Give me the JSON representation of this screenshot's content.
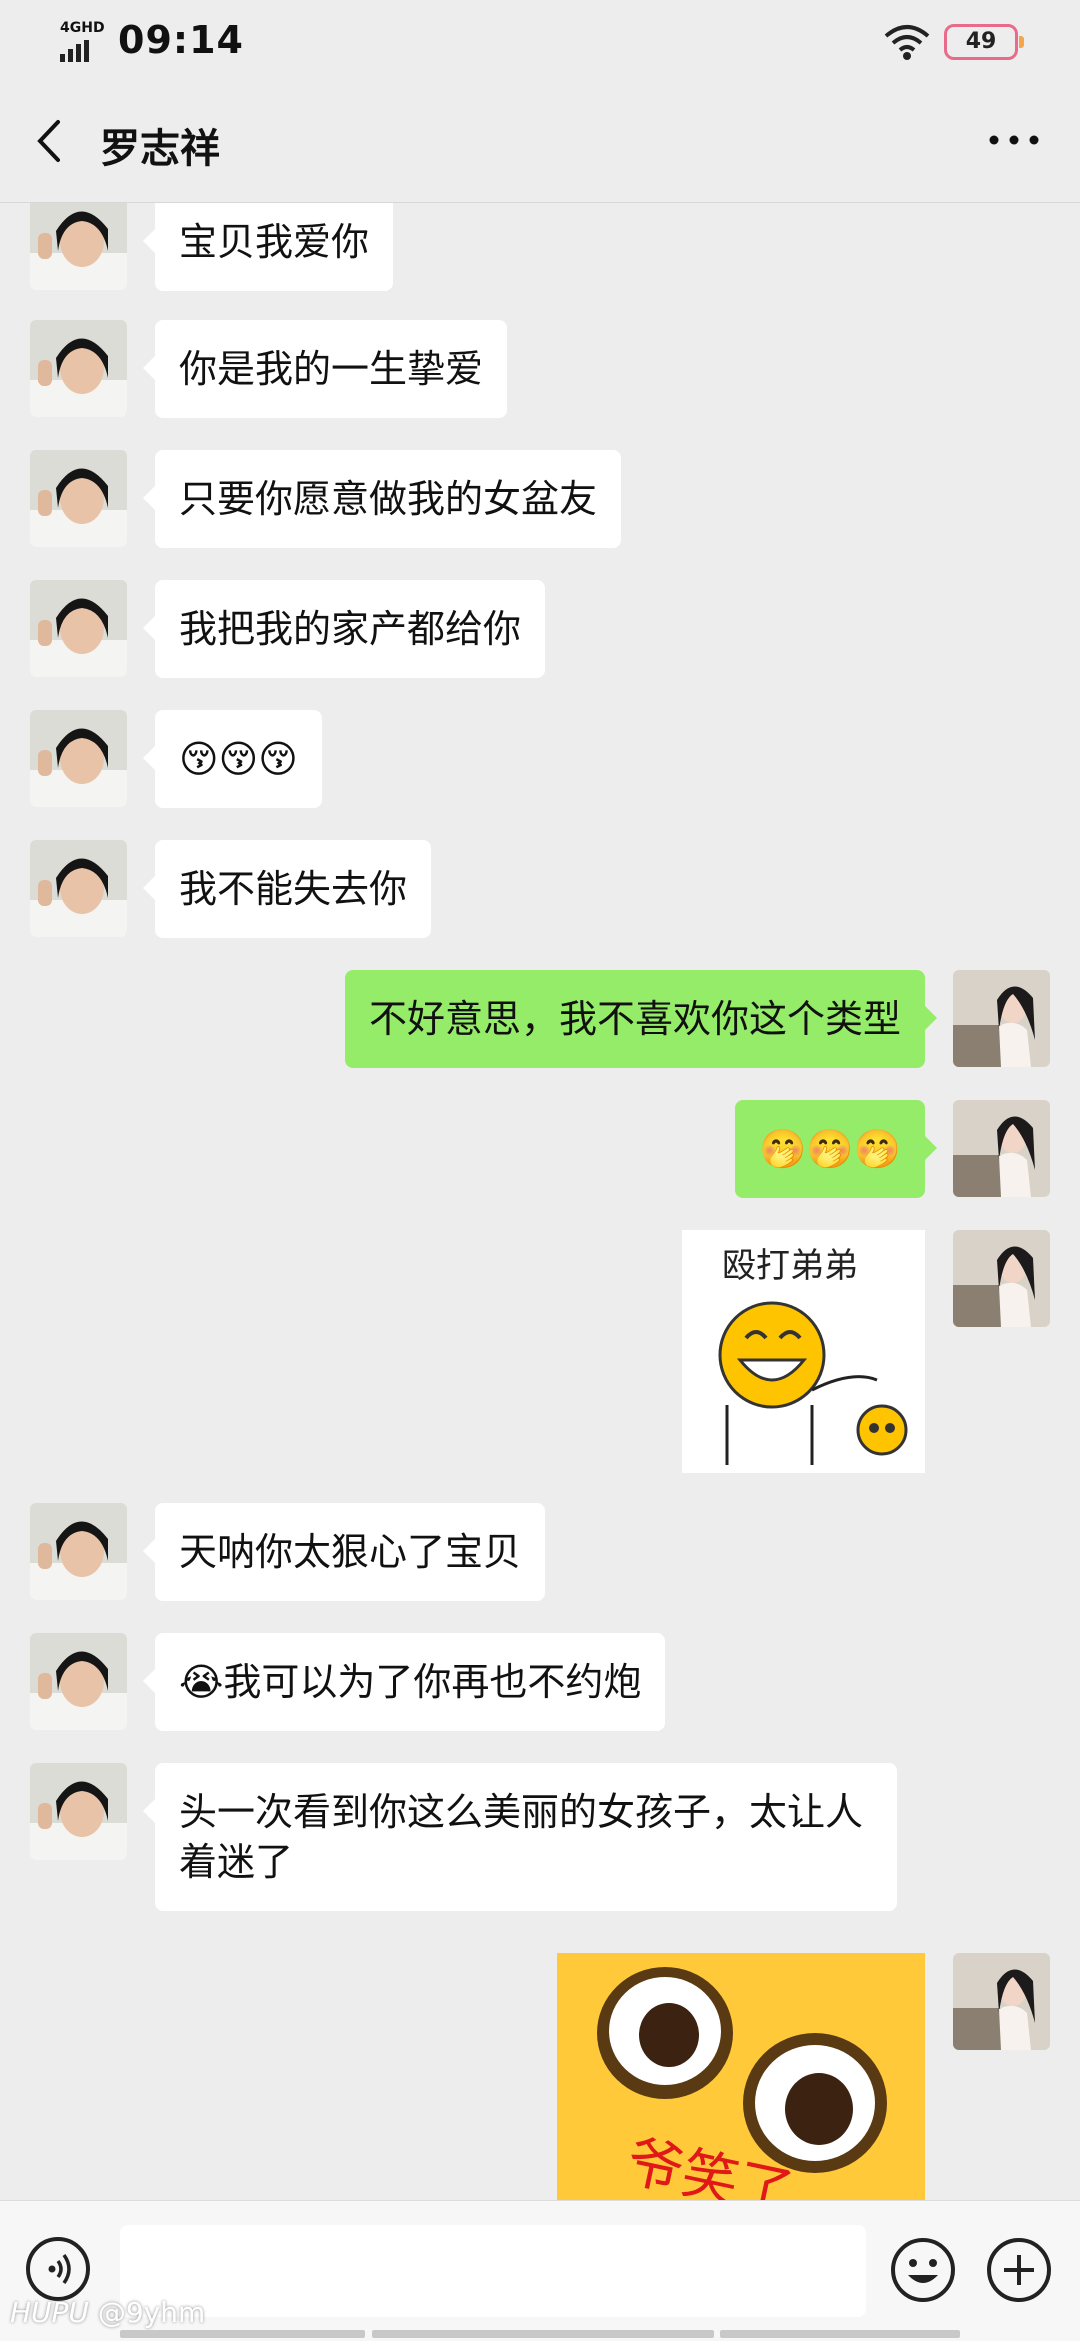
{
  "status_bar": {
    "network": "4GHD",
    "time": "09:14",
    "battery": "49"
  },
  "header": {
    "title": "罗志祥"
  },
  "messages": [
    {
      "side": "left",
      "text": "宝贝我爱你"
    },
    {
      "side": "left",
      "text": "你是我的一生挚爱"
    },
    {
      "side": "left",
      "text": "只要你愿意做我的女盆友"
    },
    {
      "side": "left",
      "text": "我把我的家产都给你"
    },
    {
      "side": "left",
      "text": "😚😚😚"
    },
    {
      "side": "left",
      "text": "我不能失去你"
    },
    {
      "side": "right",
      "text": "不好意思，我不喜欢你这个类型"
    },
    {
      "side": "right",
      "text": "🤭🤭🤭"
    },
    {
      "side": "right",
      "sticker_text": "殴打弟弟"
    },
    {
      "side": "left",
      "text": "天呐你太狠心了宝贝"
    },
    {
      "side": "left",
      "text": "😭我可以为了你再也不约炮"
    },
    {
      "side": "left",
      "text": "头一次看到你这么美丽的女孩子，太让人着迷了"
    },
    {
      "side": "right",
      "sticker_text": "爷笑了"
    }
  ],
  "watermark": {
    "brand": "HUPU",
    "handle": "@9yhm"
  },
  "icons": {
    "back": "chevron-left-icon",
    "more": "more-dots-icon",
    "voice": "voice-icon",
    "emoji": "emoji-icon",
    "plus": "plus-icon",
    "wifi": "wifi-icon"
  },
  "colors": {
    "background": "#ededed",
    "self_bubble": "#95ec69",
    "other_bubble": "#ffffff"
  }
}
